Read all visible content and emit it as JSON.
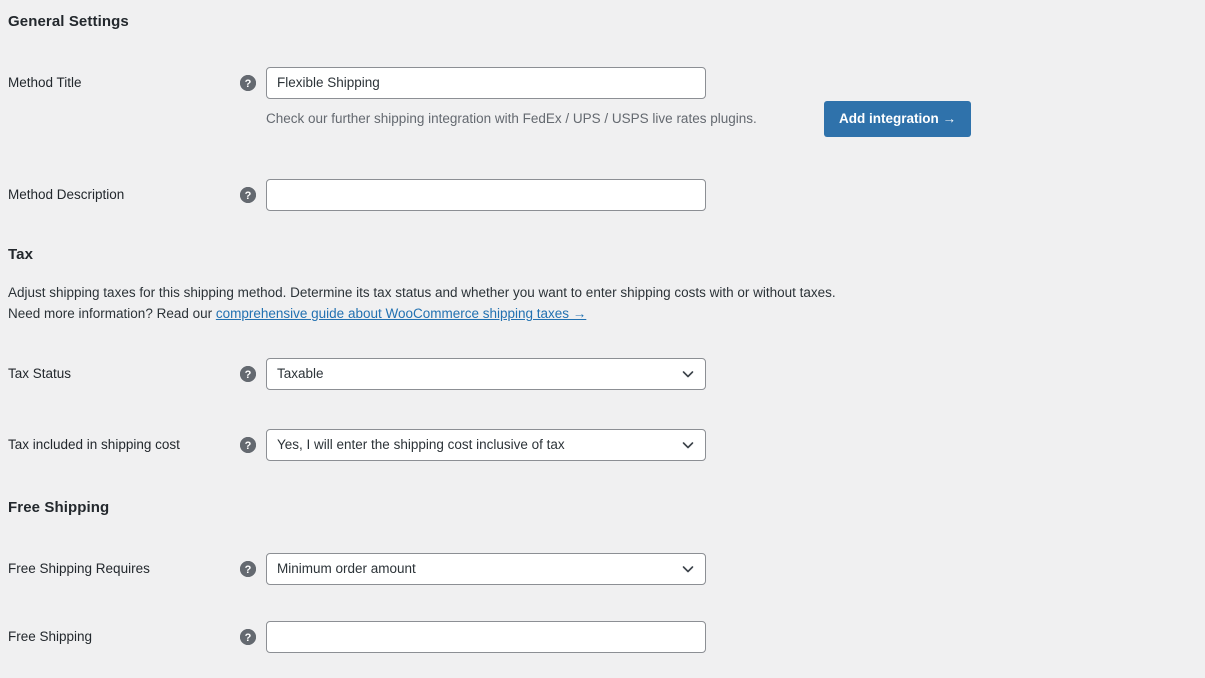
{
  "sections": {
    "general": {
      "heading": "General Settings"
    },
    "tax": {
      "heading": "Tax",
      "desc_line1": "Adjust shipping taxes for this shipping method. Determine its tax status and whether you want to enter shipping costs with or without taxes.",
      "desc_line2_prefix": "Need more information? Read our ",
      "desc_link": "comprehensive guide about WooCommerce shipping taxes →"
    },
    "free_shipping": {
      "heading": "Free Shipping"
    }
  },
  "fields": {
    "method_title": {
      "label": "Method Title",
      "value": "Flexible Shipping",
      "help": "?"
    },
    "method_description": {
      "label": "Method Description",
      "value": "",
      "help": "?"
    },
    "tax_status": {
      "label": "Tax Status",
      "value": "Taxable",
      "help": "?"
    },
    "tax_included": {
      "label": "Tax included in shipping cost",
      "value": "Yes, I will enter the shipping cost inclusive of tax",
      "help": "?"
    },
    "free_shipping_requires": {
      "label": "Free Shipping Requires",
      "value": "Minimum order amount",
      "help": "?"
    },
    "free_shipping_amount": {
      "label": "Free Shipping",
      "value": "",
      "help": "?"
    }
  },
  "integration": {
    "text": "Check our further shipping integration with FedEx / UPS / USPS live rates plugins.",
    "button_label": "Add integration →"
  },
  "colors": {
    "background": "#f0f0f1",
    "button_blue": "#2f72ab",
    "link_blue": "#2271b1",
    "border_gray": "#8c8f94",
    "help_icon_gray": "#646970"
  }
}
